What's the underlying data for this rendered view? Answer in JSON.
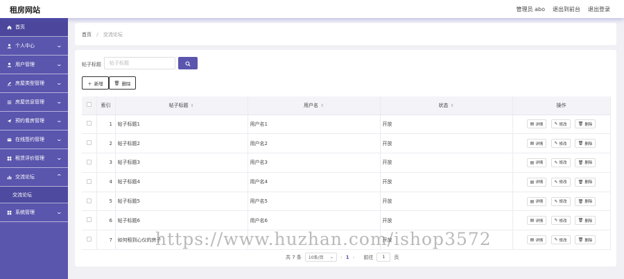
{
  "header": {
    "brand": "租房网站",
    "user_label": "管理员 abo",
    "front_link": "退出到前台",
    "logout_link": "退出登录"
  },
  "sidebar": {
    "items": [
      {
        "label": "首页",
        "icon": "home-icon",
        "arrow": false
      },
      {
        "label": "个人中心",
        "icon": "user-icon",
        "arrow": true
      },
      {
        "label": "用户管理",
        "icon": "user-icon",
        "arrow": true
      },
      {
        "label": "房屋类型管理",
        "icon": "pen-icon",
        "arrow": true
      },
      {
        "label": "房屋信息管理",
        "icon": "list-icon",
        "arrow": true
      },
      {
        "label": "预约看房管理",
        "icon": "send-icon",
        "arrow": true
      },
      {
        "label": "在线签约管理",
        "icon": "card-icon",
        "arrow": true
      },
      {
        "label": "租赁评价管理",
        "icon": "grid-icon",
        "arrow": true
      },
      {
        "label": "交流论坛",
        "icon": "chart-icon",
        "arrow": "up"
      },
      {
        "label": "交流论坛",
        "icon": "",
        "arrow": false,
        "sub": true
      },
      {
        "label": "系统管理",
        "icon": "grid-icon",
        "arrow": true
      }
    ]
  },
  "breadcrumb": {
    "home": "首页",
    "separator": "/",
    "current": "交流论坛"
  },
  "search": {
    "label": "帖子标题",
    "placeholder": "帖子标题"
  },
  "toolbar": {
    "add_label": "新增",
    "delete_label": "删除"
  },
  "table": {
    "columns": [
      "索引",
      "帖子标题",
      "用户名",
      "状态",
      "操作"
    ],
    "rows": [
      {
        "index": "1",
        "title": "帖子标题1",
        "user": "用户名1",
        "status": "开放"
      },
      {
        "index": "2",
        "title": "帖子标题2",
        "user": "用户名2",
        "status": "开放"
      },
      {
        "index": "3",
        "title": "帖子标题3",
        "user": "用户名3",
        "status": "开放"
      },
      {
        "index": "4",
        "title": "帖子标题4",
        "user": "用户名4",
        "status": "开放"
      },
      {
        "index": "5",
        "title": "帖子标题5",
        "user": "用户名5",
        "status": "开放"
      },
      {
        "index": "6",
        "title": "帖子标题6",
        "user": "用户名6",
        "status": "开放"
      },
      {
        "index": "7",
        "title": "如何租到心仪的房子",
        "user": "",
        "status": "开放"
      }
    ],
    "actions": {
      "detail": "详情",
      "edit": "修改",
      "delete": "删除"
    }
  },
  "pagination": {
    "total": "共 7 条",
    "page_size": "10条/页",
    "current_page": "1",
    "goto_label": "前往",
    "goto_value": "1",
    "page_unit": "页"
  },
  "watermark": "https://www.huzhan.com/ishop3572",
  "colors": {
    "accent": "#5a55ad",
    "sidebar": "#5a55ad"
  }
}
